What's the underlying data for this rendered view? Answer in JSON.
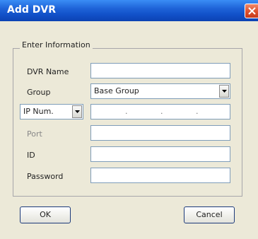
{
  "window": {
    "title": "Add DVR"
  },
  "group_label": "Enter Information",
  "fields": {
    "dvr_name": {
      "label": "DVR Name",
      "value": ""
    },
    "group": {
      "label": "Group",
      "value": "Base Group"
    },
    "address_type": {
      "value": "IP Num."
    },
    "ip": {
      "separators": [
        ".",
        ".",
        "."
      ]
    },
    "port": {
      "label": "Port",
      "value": ""
    },
    "id": {
      "label": "ID",
      "value": ""
    },
    "password": {
      "label": "Password",
      "value": ""
    }
  },
  "buttons": {
    "ok": "OK",
    "cancel": "Cancel"
  },
  "colors": {
    "title_bar": "#1150c8",
    "close_button": "#e0532f",
    "dialog_bg": "#ece9d8"
  },
  "icons": {
    "close": "close-icon",
    "dropdown": "chevron-down-icon"
  }
}
